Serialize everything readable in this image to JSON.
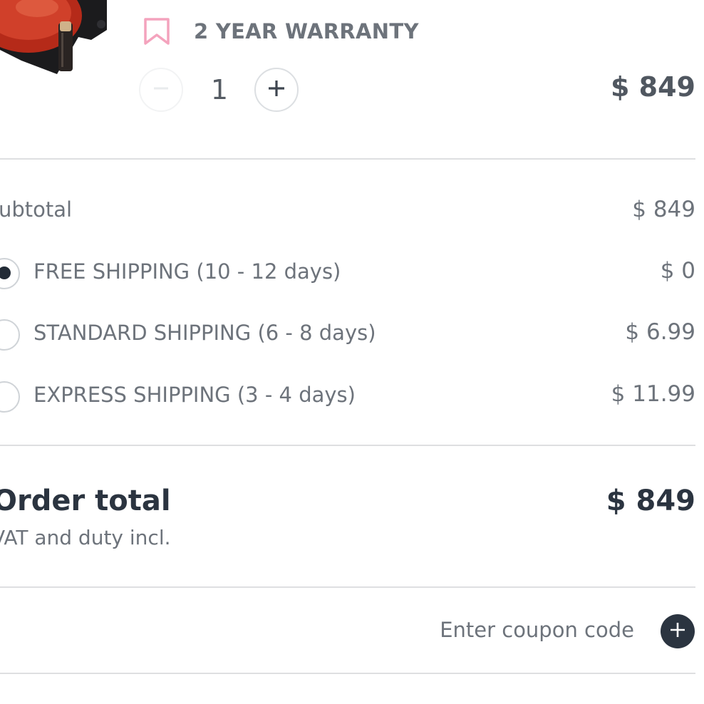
{
  "product": {
    "warranty_label": "2 YEAR WARRANTY",
    "quantity": "1",
    "price": "$ 849"
  },
  "summary": {
    "subtotal_label": "ubtotal",
    "subtotal_value": "$ 849",
    "shipping_options": [
      {
        "label": "FREE SHIPPING (10 - 12 days)",
        "price": "$ 0",
        "selected": true
      },
      {
        "label": "STANDARD SHIPPING (6 - 8 days)",
        "price": "$ 6.99",
        "selected": false
      },
      {
        "label": "EXPRESS SHIPPING (3 - 4 days)",
        "price": "$ 11.99",
        "selected": false
      }
    ],
    "order_total_label": "Order total",
    "order_total_value": "$ 849",
    "vat_note": "VAT and duty incl."
  },
  "coupon": {
    "placeholder": "Enter coupon code"
  },
  "colors": {
    "accent_pink": "#f4a3bd",
    "dark": "#2b3440",
    "divider": "#dedfe1",
    "muted_text": "#6d737b"
  },
  "icons": {
    "warranty": "bookmark-icon",
    "minus": "minus-icon",
    "plus": "plus-icon",
    "coupon_add": "plus-circle-icon"
  }
}
